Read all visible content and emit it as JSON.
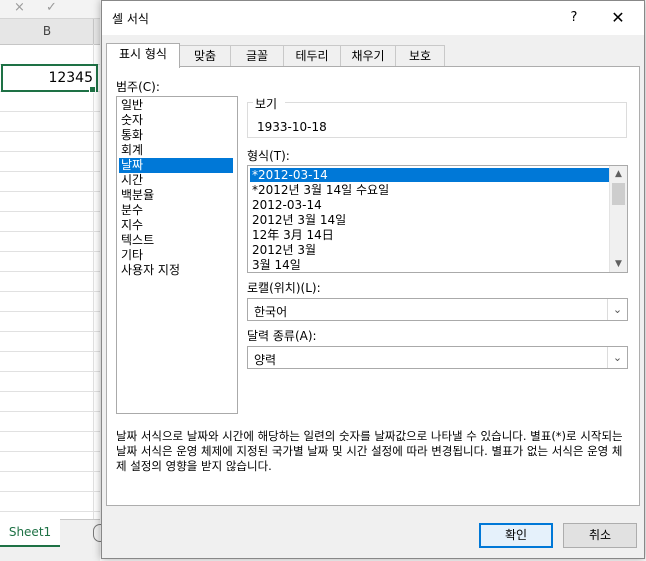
{
  "sheet": {
    "column_b": "B",
    "cell_value": "12345",
    "sheet_tab": "Sheet1",
    "top_glyphs": [
      "×",
      "✓"
    ]
  },
  "dialog": {
    "title": "셀 서식",
    "help": "?",
    "close": "✕",
    "tabs": [
      "표시 형식",
      "맞춤",
      "글꼴",
      "테두리",
      "채우기",
      "보호"
    ],
    "active_tab": "표시 형식",
    "category_label": "범주(C):",
    "categories": [
      "일반",
      "숫자",
      "통화",
      "회계",
      "날짜",
      "시간",
      "백분율",
      "분수",
      "지수",
      "텍스트",
      "기타",
      "사용자 지정"
    ],
    "selected_category": "날짜",
    "sample_label": "보기",
    "sample_value": "1933-10-18",
    "type_label": "형식(T):",
    "types": [
      "*2012-03-14",
      "*2012년 3월 14일 수요일",
      "2012-03-14",
      "2012년 3월 14일",
      "12年 3月 14日",
      "2012년 3월",
      "3월 14일"
    ],
    "selected_type": "*2012-03-14",
    "locale_label": "로캘(위치)(L):",
    "locale_value": "한국어",
    "calendar_label": "달력 종류(A):",
    "calendar_value": "양력",
    "description": "날짜 서식으로 날짜와 시간에 해당하는 일련의 숫자를 날짜값으로 나타낼 수 있습니다. 별표(*)로 시작되는 날짜 서식은 운영 체제에 지정된 국가별 날짜 및 시간 설정에 따라 변경됩니다. 별표가 없는 서식은 운영 체제 설정의 영향을 받지 않습니다.",
    "ok": "확인",
    "cancel": "취소"
  },
  "colors": {
    "selection": "#0078d7",
    "excel_green": "#1e7145"
  }
}
